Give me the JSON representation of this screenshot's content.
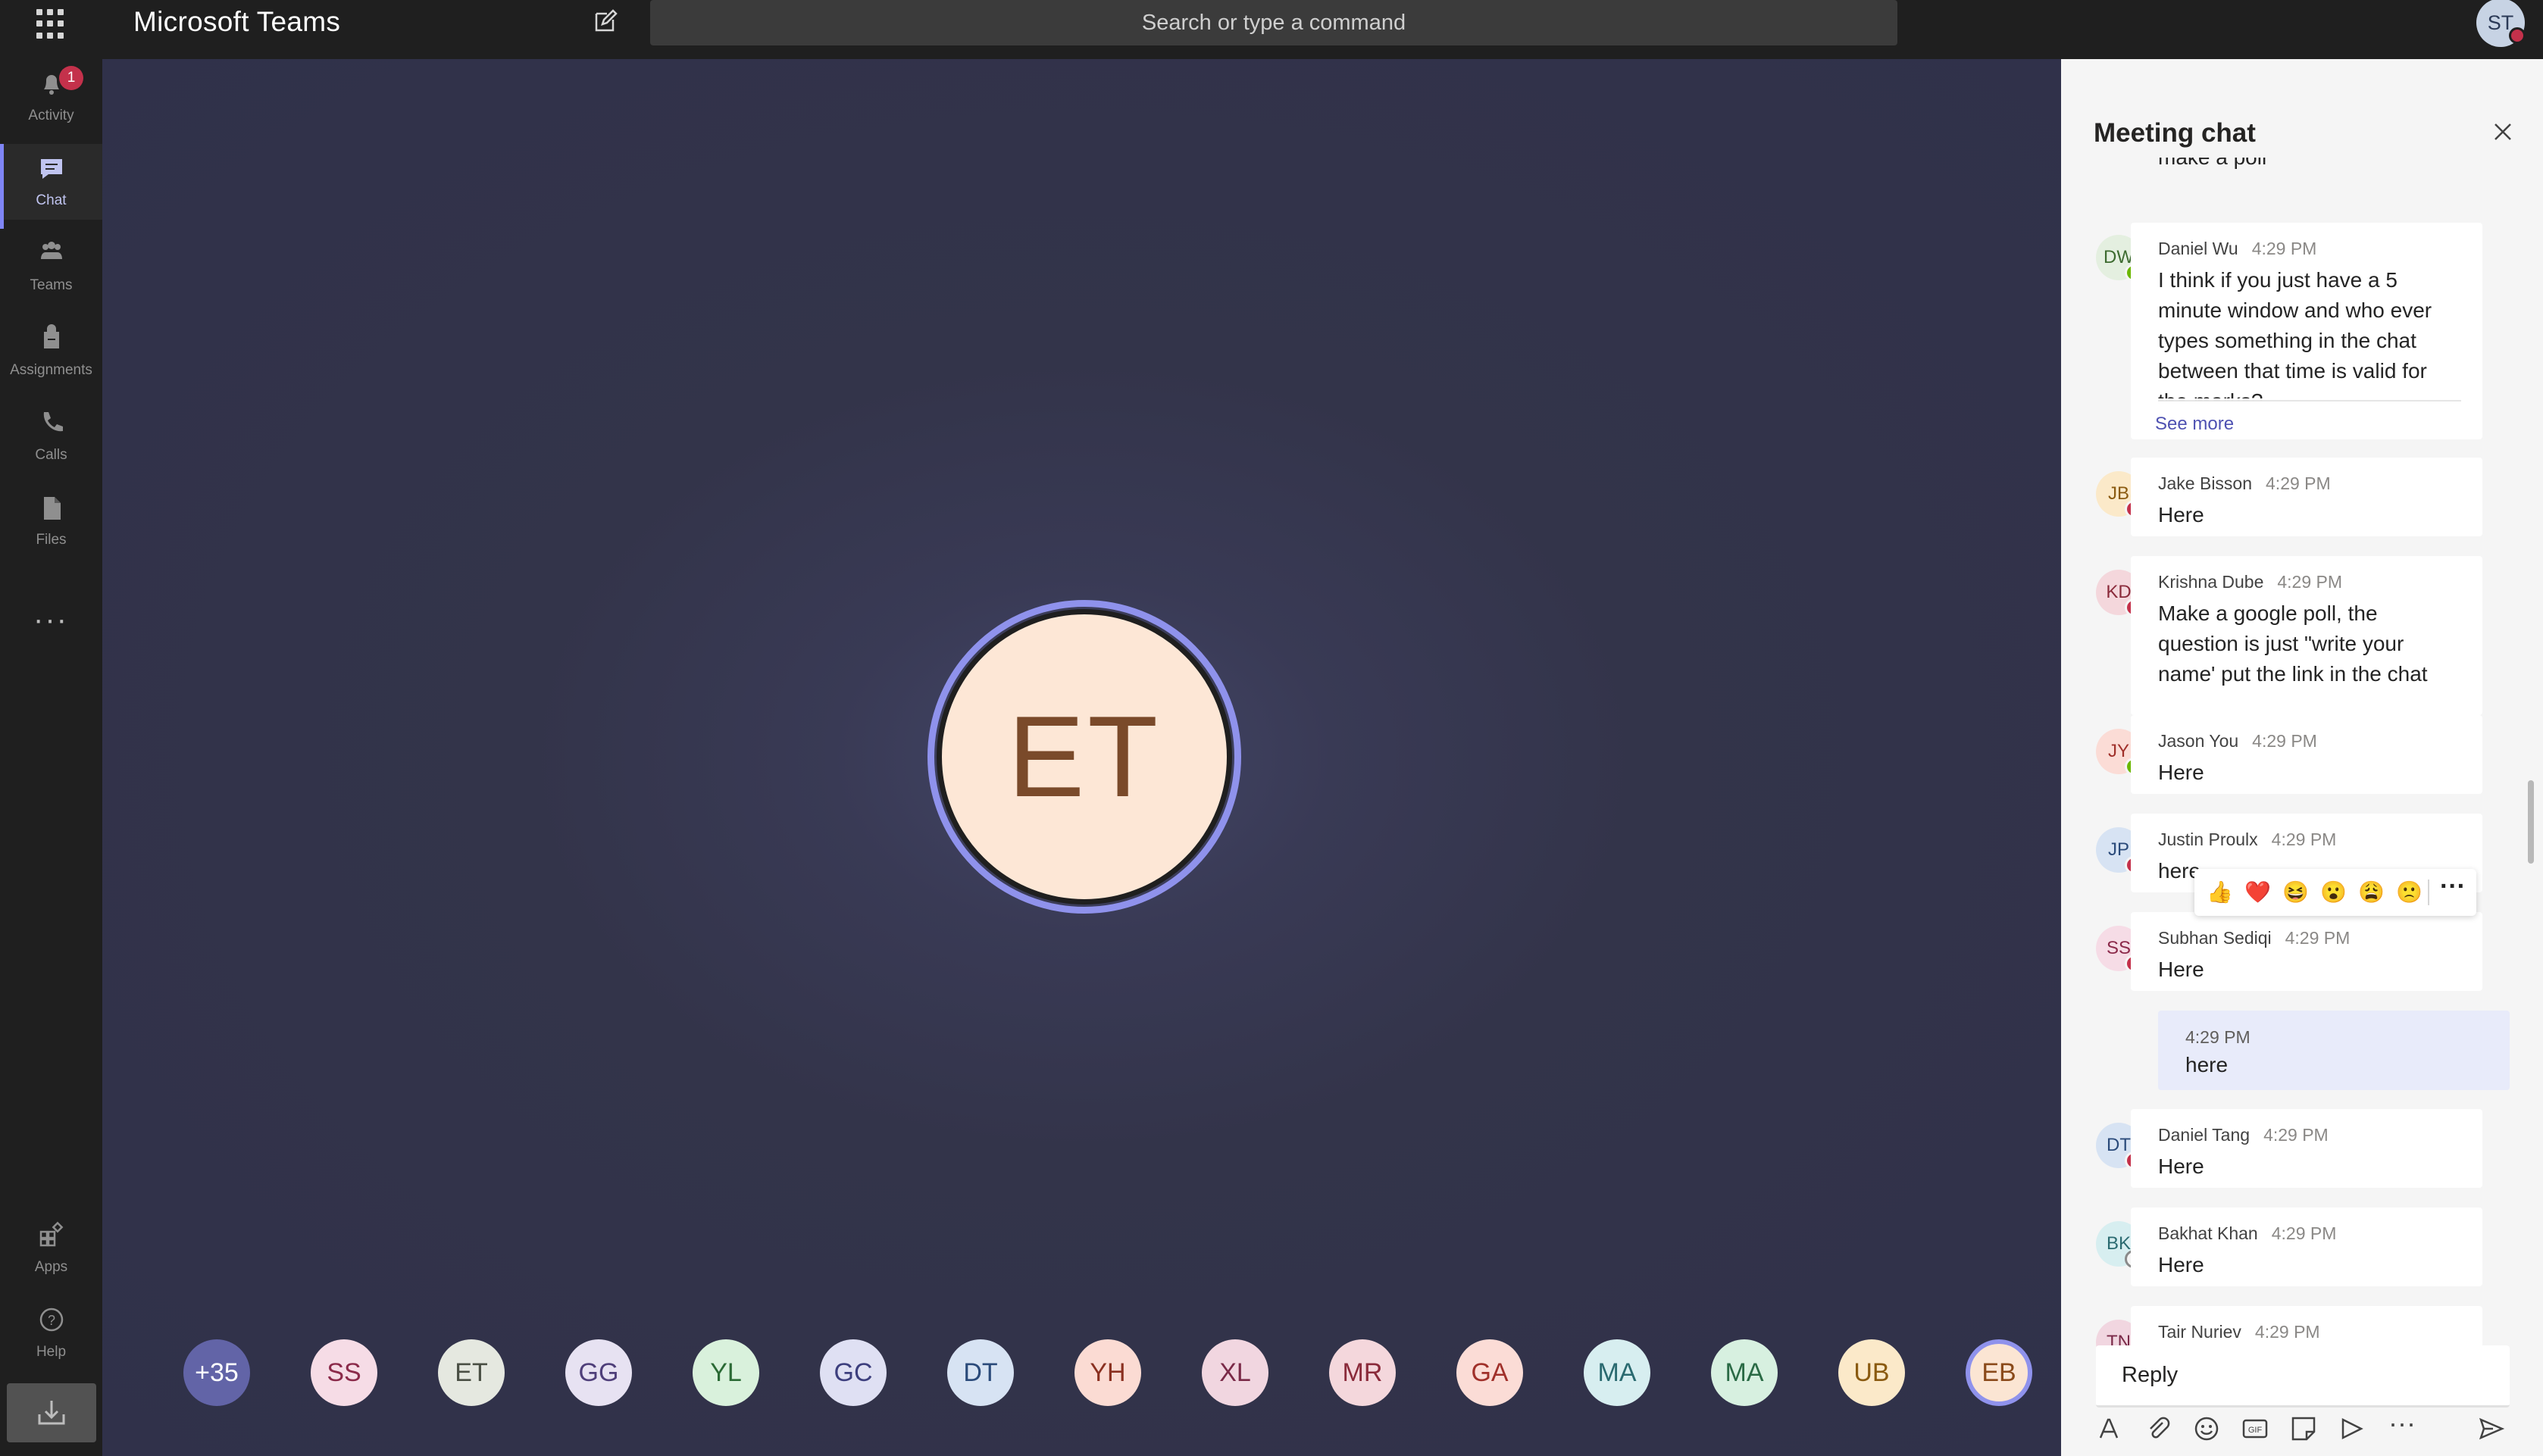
{
  "app": {
    "title": "Microsoft Teams",
    "search_placeholder": "Search or type a command",
    "user_initials": "ST"
  },
  "rail": {
    "items": [
      {
        "label": "Activity",
        "icon": "bell-icon",
        "badge": "1"
      },
      {
        "label": "Chat",
        "icon": "chat-icon"
      },
      {
        "label": "Teams",
        "icon": "teams-icon"
      },
      {
        "label": "Assignments",
        "icon": "assignments-icon"
      },
      {
        "label": "Calls",
        "icon": "phone-icon"
      },
      {
        "label": "Files",
        "icon": "file-icon"
      }
    ],
    "more": "···",
    "bottom": [
      {
        "label": "Apps",
        "icon": "apps-icon"
      },
      {
        "label": "Help",
        "icon": "help-icon"
      }
    ]
  },
  "stage": {
    "active_speaker": "ET",
    "participants": [
      {
        "initials": "+35",
        "bg": "#6264a7",
        "fg": "#ffffff"
      },
      {
        "initials": "SS",
        "bg": "#f6dce6",
        "fg": "#8b2a4a"
      },
      {
        "initials": "ET",
        "bg": "#e5e8e0",
        "fg": "#4a4f44"
      },
      {
        "initials": "GG",
        "bg": "#e7e2f2",
        "fg": "#4f3f7a"
      },
      {
        "initials": "YL",
        "bg": "#d9f1dc",
        "fg": "#2b6a35"
      },
      {
        "initials": "GC",
        "bg": "#dfe0f3",
        "fg": "#3d3f7e"
      },
      {
        "initials": "DT",
        "bg": "#d7e3f3",
        "fg": "#2a4a7a"
      },
      {
        "initials": "YH",
        "bg": "#fbdbd3",
        "fg": "#8a3020"
      },
      {
        "initials": "XL",
        "bg": "#f1d6e0",
        "fg": "#7a2a48"
      },
      {
        "initials": "MR",
        "bg": "#f4d7dc",
        "fg": "#8a2a3a"
      },
      {
        "initials": "GA",
        "bg": "#fbdcd6",
        "fg": "#a0302a"
      },
      {
        "initials": "MA",
        "bg": "#d7eef0",
        "fg": "#2a6a70"
      },
      {
        "initials": "MA",
        "bg": "#d7f0e0",
        "fg": "#2a6a45"
      },
      {
        "initials": "UB",
        "bg": "#fbe9c9",
        "fg": "#8a5a10"
      },
      {
        "initials": "EB",
        "bg": "#fbe5d3",
        "fg": "#8a4a1a"
      }
    ]
  },
  "chat": {
    "title": "Meeting chat",
    "clipped_top": "make a poll",
    "messages": [
      {
        "initials": "DW",
        "name": "Daniel Wu",
        "time": "4:29 PM",
        "text": "I think if you just have a 5 minute window and who ever types something in the chat between that time is valid for the marks?",
        "status": "green",
        "av_bg": "#e4efe0",
        "av_fg": "#3d6b30"
      },
      {
        "initials": "JB",
        "name": "Jake Bisson",
        "time": "4:29 PM",
        "text": "Here",
        "status": "red",
        "av_bg": "#fbe9c9",
        "av_fg": "#8a5a10"
      },
      {
        "initials": "KD",
        "name": "Krishna Dube",
        "time": "4:29 PM",
        "text": "Make a google poll, the question is just \"write your name' put the link in the chat",
        "status": "red",
        "av_bg": "#f4d7dc",
        "av_fg": "#8a2a3a"
      },
      {
        "initials": "JY",
        "name": "Jason You",
        "time": "4:29 PM",
        "text": "Here",
        "status": "green",
        "av_bg": "#fbdcd6",
        "av_fg": "#a0302a"
      },
      {
        "initials": "JP",
        "name": "Justin Proulx",
        "time": "4:29 PM",
        "text": "here",
        "status": "red",
        "av_bg": "#d7e3f3",
        "av_fg": "#2a4a7a"
      },
      {
        "initials": "SS",
        "name": "Subhan Sediqi",
        "time": "4:29 PM",
        "text": "Here",
        "status": "red",
        "av_bg": "#f6dce6",
        "av_fg": "#8b2a4a"
      },
      {
        "initials": "DT",
        "name": "Daniel Tang",
        "time": "4:29 PM",
        "text": "Here",
        "status": "red",
        "av_bg": "#d7e3f3",
        "av_fg": "#2a4a7a"
      },
      {
        "initials": "BK",
        "name": "Bakhat Khan",
        "time": "4:29 PM",
        "text": "Here",
        "status": "off",
        "av_bg": "#d7eef0",
        "av_fg": "#2a6a70"
      },
      {
        "initials": "TN",
        "name": "Tair Nuriev",
        "time": "4:29 PM",
        "text": "",
        "status": "red",
        "av_bg": "#f1d6e0",
        "av_fg": "#7a2a48"
      }
    ],
    "see_more": "See more",
    "self_message": {
      "time": "4:29 PM",
      "text": "here"
    },
    "reactions": [
      "👍",
      "❤️",
      "😆",
      "😮",
      "😩",
      "🙁"
    ],
    "reply_placeholder": "Reply"
  }
}
